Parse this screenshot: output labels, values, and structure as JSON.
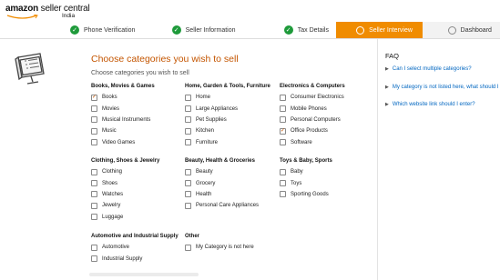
{
  "header": {
    "logo_text": "amazon",
    "logo_suffix": "seller central",
    "logo_region": "India"
  },
  "steps": [
    {
      "label": "Phone Verification",
      "state": "done"
    },
    {
      "label": "Seller Information",
      "state": "done"
    },
    {
      "label": "Tax Details",
      "state": "done"
    },
    {
      "label": "Seller Interview",
      "state": "active"
    },
    {
      "label": "Dashboard",
      "state": "pending"
    }
  ],
  "main": {
    "title": "Choose categories you wish to sell",
    "subtitle": "Choose categories you wish to sell",
    "groups": [
      {
        "heading": "Books, Movies & Games",
        "items": [
          {
            "label": "Books",
            "checked": true
          },
          {
            "label": "Movies",
            "checked": false
          },
          {
            "label": "Musical Instruments",
            "checked": false
          },
          {
            "label": "Music",
            "checked": false
          },
          {
            "label": "Video Games",
            "checked": false
          }
        ]
      },
      {
        "heading": "Home, Garden & Tools, Furniture",
        "items": [
          {
            "label": "Home",
            "checked": false
          },
          {
            "label": "Large Appliances",
            "checked": false
          },
          {
            "label": "Pet Supplies",
            "checked": false
          },
          {
            "label": "Kitchen",
            "checked": false
          },
          {
            "label": "Furniture",
            "checked": false
          }
        ]
      },
      {
        "heading": "Electronics & Computers",
        "items": [
          {
            "label": "Consumer Electronics",
            "checked": false
          },
          {
            "label": "Mobile Phones",
            "checked": false
          },
          {
            "label": "Personal Computers",
            "checked": false
          },
          {
            "label": "Office Products",
            "checked": true
          },
          {
            "label": "Software",
            "checked": false
          }
        ]
      },
      {
        "heading": "Clothing, Shoes & Jewelry",
        "items": [
          {
            "label": "Clothing",
            "checked": false
          },
          {
            "label": "Shoes",
            "checked": false
          },
          {
            "label": "Watches",
            "checked": false
          },
          {
            "label": "Jewelry",
            "checked": false
          },
          {
            "label": "Luggage",
            "checked": false
          }
        ]
      },
      {
        "heading": "Beauty, Health & Groceries",
        "items": [
          {
            "label": "Beauty",
            "checked": false
          },
          {
            "label": "Grocery",
            "checked": false
          },
          {
            "label": "Health",
            "checked": false
          },
          {
            "label": "Personal Care Appliances",
            "checked": false
          }
        ]
      },
      {
        "heading": "Toys & Baby, Sports",
        "items": [
          {
            "label": "Baby",
            "checked": false
          },
          {
            "label": "Toys",
            "checked": false
          },
          {
            "label": "Sporting Goods",
            "checked": false
          }
        ]
      },
      {
        "heading": "Automotive and Industrial Supply",
        "items": [
          {
            "label": "Automotive",
            "checked": false
          },
          {
            "label": "Industrial Supply",
            "checked": false
          }
        ]
      },
      {
        "heading": "Other",
        "items": [
          {
            "label": "My Category is not here",
            "checked": false
          }
        ]
      }
    ]
  },
  "faq": {
    "title": "FAQ",
    "items": [
      "Can I select multiple categories?",
      "My category is not listed here, what should I",
      "Which website link should I enter?"
    ]
  },
  "colors": {
    "accent": "#c45500",
    "step_active": "#f08c00",
    "step_done": "#1e9a3a",
    "link": "#0066c0"
  }
}
